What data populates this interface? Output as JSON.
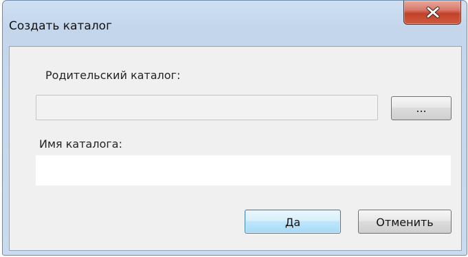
{
  "window": {
    "title": "Создать каталог",
    "close_icon": "close-icon"
  },
  "form": {
    "parent_label": "Родительский каталог:",
    "parent_value": "",
    "browse_label": "...",
    "name_label": "Имя каталога:",
    "name_value": ""
  },
  "buttons": {
    "ok_label": "Да",
    "cancel_label": "Отменить"
  },
  "colors": {
    "frame": "#c9dbee",
    "close_button": "#c2412a",
    "default_button_border": "#3c7fb1"
  }
}
